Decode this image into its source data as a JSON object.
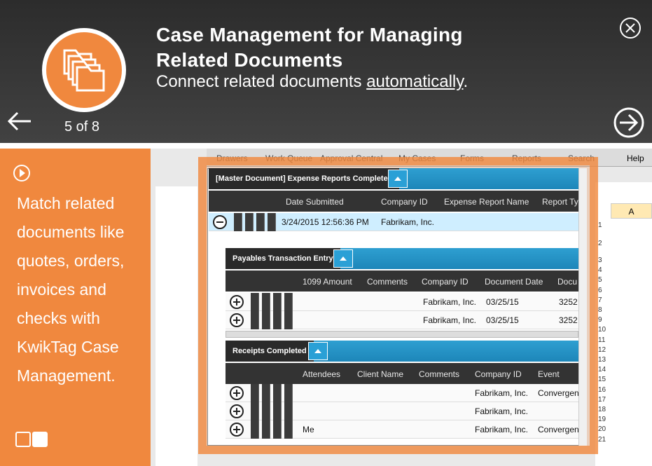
{
  "header": {
    "title_line1": "Case Management for Managing",
    "title_line2": "Related Documents",
    "subtitle_pre": "Connect related documents ",
    "subtitle_link": "automatically",
    "subtitle_post": ".",
    "counter": "5 of 8"
  },
  "sidebar": {
    "text": "Match related documents like quotes, orders, invoices and checks with KwikTag Case Management."
  },
  "app": {
    "menu": [
      "Drawers",
      "Work Queue",
      "Approval Central",
      "My Cases",
      "Forms",
      "Reports",
      "Search",
      "Help"
    ],
    "grid_col": "A",
    "grid_rows": [
      "1",
      "2",
      "3",
      "4",
      "5",
      "6",
      "7",
      "8",
      "9",
      "10",
      "11",
      "12",
      "13",
      "14",
      "15",
      "16",
      "17",
      "18",
      "19",
      "20",
      "21"
    ]
  },
  "master": {
    "label": "[Master Document] Expense Reports Completed",
    "columns": [
      "Date Submitted",
      "Company ID",
      "Expense Report Name",
      "Report Ty"
    ],
    "row": {
      "date": "3/24/2015 12:56:36 PM",
      "company": "Fabrikam, Inc."
    }
  },
  "payables": {
    "label": "Payables Transaction Entry",
    "columns": [
      "1099 Amount",
      "Comments",
      "Company ID",
      "Document Date",
      "Docu"
    ],
    "rows": [
      {
        "company": "Fabrikam, Inc.",
        "date": "03/25/15",
        "doc": "3252"
      },
      {
        "company": "Fabrikam, Inc.",
        "date": "03/25/15",
        "doc": "3252"
      }
    ]
  },
  "receipts": {
    "label": "Receipts Completed",
    "columns": [
      "Attendees",
      "Client Name",
      "Comments",
      "Company ID",
      "Event"
    ],
    "rows": [
      {
        "attendees": "",
        "company": "Fabrikam, Inc.",
        "event": "Convergen"
      },
      {
        "attendees": "",
        "company": "Fabrikam, Inc.",
        "event": ""
      },
      {
        "attendees": "Me",
        "company": "Fabrikam, Inc.",
        "event": "Convergen"
      }
    ]
  },
  "colors": {
    "accent": "#f0883e",
    "blue": "#2aa0d6",
    "header_bg": "#333333"
  },
  "icons": [
    "folders-icon",
    "back-arrow-icon",
    "next-arrow-icon",
    "close-icon",
    "play-icon",
    "collapse-icon",
    "expand-icon",
    "chevron-up-icon"
  ]
}
